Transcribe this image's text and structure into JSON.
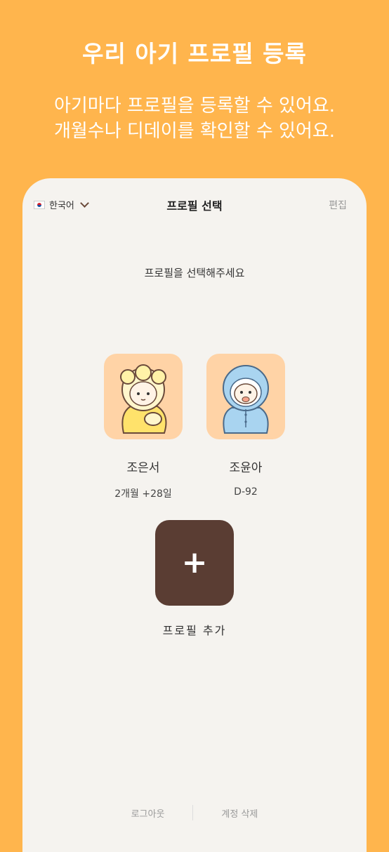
{
  "promo": {
    "title": "우리 아기 프로필 등록",
    "line1": "아기마다 프로필을 등록할 수 있어요.",
    "line2": "개월수나 디데이를 확인할 수 있어요."
  },
  "header": {
    "language": "한국어",
    "title": "프로필 선택",
    "edit": "편집"
  },
  "prompt": "프로필을 선택해주세요",
  "profiles": [
    {
      "name": "조은서",
      "age": "2개월 +28일"
    },
    {
      "name": "조윤아",
      "age": "D-92"
    }
  ],
  "add": {
    "icon": "+",
    "label": "프로필 추가"
  },
  "footer": {
    "logout": "로그아웃",
    "delete": "계정 삭제"
  },
  "colors": {
    "background": "#FFB54D",
    "screen": "#F5F3EF",
    "avatar_bg": "#FFD3A6",
    "add_button": "#5A3D33"
  },
  "icons": {
    "flag": "korea-flag-icon",
    "chevron": "chevron-down-icon",
    "add": "plus-icon"
  }
}
